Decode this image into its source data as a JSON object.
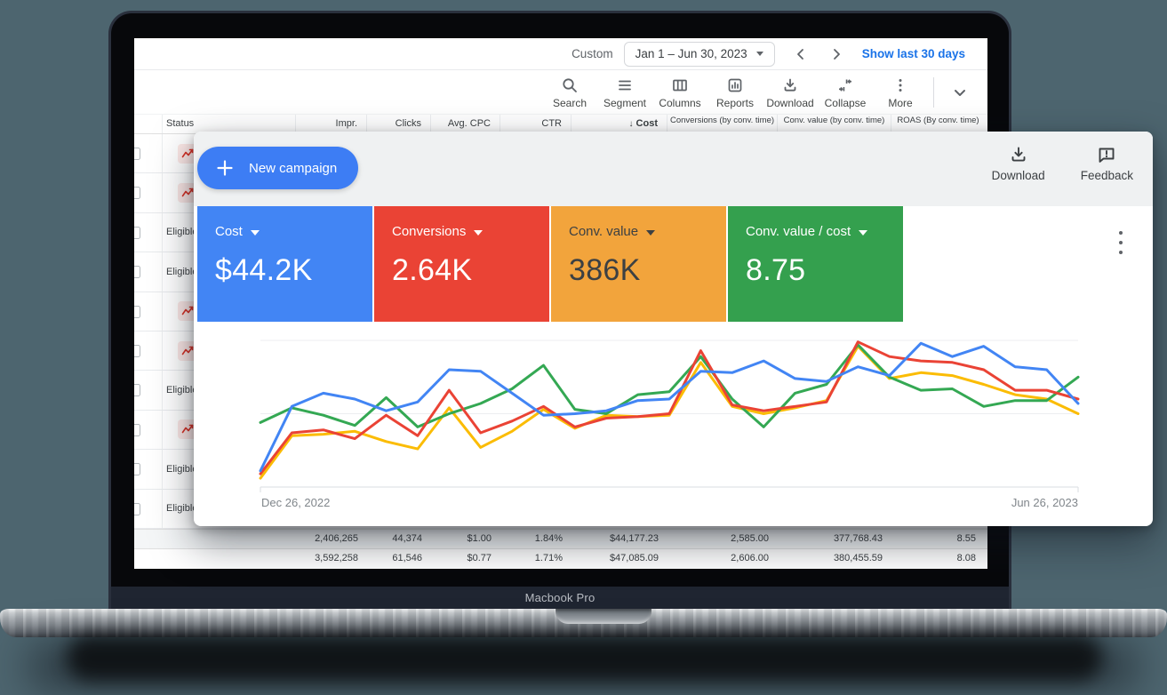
{
  "page": {
    "brand_label": "Macbook Pro"
  },
  "top_bar": {
    "custom_label": "Custom",
    "date_range": "Jan 1 – Jun 30, 2023",
    "show_last_label": "Show last 30 days"
  },
  "toolbar": {
    "items": [
      {
        "id": "search",
        "label": "Search"
      },
      {
        "id": "segment",
        "label": "Segment"
      },
      {
        "id": "columns",
        "label": "Columns"
      },
      {
        "id": "reports",
        "label": "Reports"
      },
      {
        "id": "download",
        "label": "Download"
      },
      {
        "id": "collapse",
        "label": "Collapse"
      },
      {
        "id": "more",
        "label": "More"
      }
    ]
  },
  "table": {
    "headers": {
      "status": "Status",
      "impr": "Impr.",
      "clicks": "Clicks",
      "avg_cpc": "Avg. CPC",
      "ctr": "CTR",
      "cost_sort_icon": "↓",
      "cost": "Cost",
      "conversions": "Conversions (by conv. time)",
      "conv_value": "Conv. value (by conv. time)",
      "roas": "ROAS (By conv. time)"
    },
    "rows": [
      {
        "status_type": "chart-icon",
        "label": ""
      },
      {
        "status_type": "chart-icon",
        "label": ""
      },
      {
        "status_type": "eligible",
        "label": "Eligible"
      },
      {
        "status_type": "eligible",
        "label": "Eligible"
      },
      {
        "status_type": "chart-icon",
        "label": ""
      },
      {
        "status_type": "chart-icon",
        "label": ""
      },
      {
        "status_type": "eligible",
        "label": "Eligible"
      },
      {
        "status_type": "chart-icon",
        "label": ""
      },
      {
        "status_type": "eligible",
        "label": "Eligible"
      },
      {
        "status_type": "eligible",
        "label": "Eligible"
      }
    ],
    "totals": [
      {
        "impr": "2,406,265",
        "clicks": "44,374",
        "avg_cpc": "$1.00",
        "ctr": "1.84%",
        "cost": "$44,177.23",
        "conversions": "2,585.00",
        "conv_value": "377,768.43",
        "roas": "8.55"
      },
      {
        "impr": "3,592,258",
        "clicks": "61,546",
        "avg_cpc": "$0.77",
        "ctr": "1.71%",
        "cost": "$47,085.09",
        "conversions": "2,606.00",
        "conv_value": "380,455.59",
        "roas": "8.08"
      }
    ]
  },
  "overlay": {
    "new_campaign_label": "New campaign",
    "download_label": "Download",
    "feedback_label": "Feedback",
    "scorecards": [
      {
        "label": "Cost",
        "value": "$44.2K",
        "bg": "#4285F4",
        "text": "#ffffff"
      },
      {
        "label": "Conversions",
        "value": "2.64K",
        "bg": "#EA4335",
        "text": "#ffffff"
      },
      {
        "label": "Conv. value",
        "value": "386K",
        "bg": "#F2A43C",
        "text": "#3c4043"
      },
      {
        "label": "Conv. value / cost",
        "value": "8.75",
        "bg": "#34A04E",
        "text": "#ffffff"
      }
    ]
  },
  "chart_data": {
    "type": "line",
    "title": "Overview performance trend",
    "x_start_label": "Dec 26, 2022",
    "x_end_label": "Jun 26, 2023",
    "x_unit": "week",
    "points_count": 27,
    "ylim": [
      0,
      100
    ],
    "grid": true,
    "note": "values are normalized 0-100 of plot height, read from pixels",
    "series": [
      {
        "name": "Cost",
        "color": "#4285F4",
        "values": [
          11,
          55,
          64,
          60,
          52,
          58,
          80,
          79,
          64,
          49,
          50,
          52,
          59,
          60,
          79,
          78,
          86,
          74,
          72,
          82,
          76,
          98,
          89,
          96,
          82,
          80,
          57
        ]
      },
      {
        "name": "Conversions",
        "color": "#EA4335",
        "values": [
          9,
          37,
          39,
          33,
          49,
          35,
          66,
          37,
          45,
          55,
          41,
          47,
          48,
          50,
          93,
          56,
          52,
          55,
          58,
          99,
          89,
          86,
          85,
          80,
          66,
          66,
          60
        ]
      },
      {
        "name": "Conv. value",
        "color": "#FBBC04",
        "values": [
          6,
          35,
          36,
          38,
          31,
          26,
          54,
          27,
          38,
          53,
          40,
          49,
          48,
          49,
          85,
          55,
          50,
          54,
          59,
          96,
          74,
          78,
          76,
          70,
          63,
          60,
          50
        ]
      },
      {
        "name": "Conv. value / cost",
        "color": "#34A853",
        "values": [
          44,
          54,
          49,
          42,
          61,
          41,
          50,
          57,
          67,
          83,
          53,
          50,
          63,
          65,
          89,
          60,
          41,
          64,
          70,
          97,
          75,
          66,
          67,
          55,
          59,
          59,
          75
        ]
      }
    ]
  }
}
